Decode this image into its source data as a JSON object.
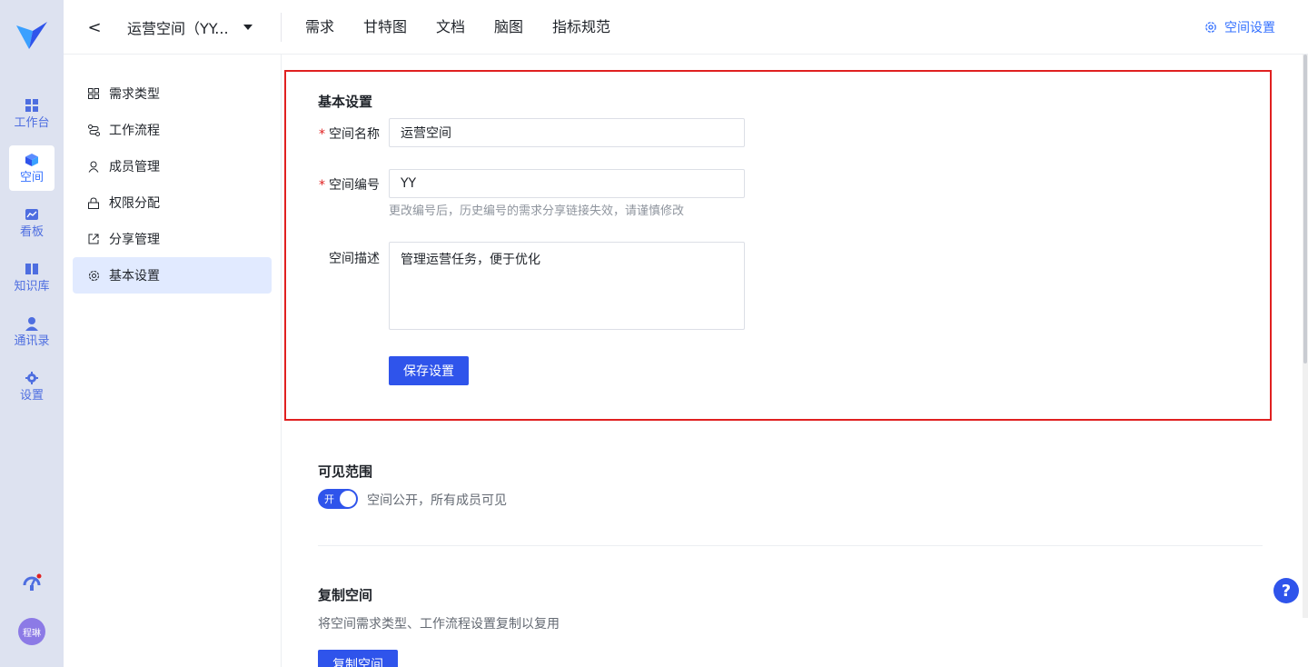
{
  "rail": {
    "items": [
      {
        "label": "工作台",
        "icon": "dashboard-icon"
      },
      {
        "label": "空间",
        "icon": "cube-icon",
        "active": true
      },
      {
        "label": "看板",
        "icon": "chart-icon"
      },
      {
        "label": "知识库",
        "icon": "book-icon"
      },
      {
        "label": "通讯录",
        "icon": "contacts-icon"
      },
      {
        "label": "设置",
        "icon": "gear-icon"
      }
    ],
    "avatar_text": "程琳"
  },
  "topbar": {
    "back": "<",
    "space_name": "运营空间（YY...",
    "tabs": [
      "需求",
      "甘特图",
      "文档",
      "脑图",
      "指标规范"
    ],
    "settings_label": "空间设置"
  },
  "subnav": {
    "items": [
      {
        "label": "需求类型",
        "icon": "grid-icon"
      },
      {
        "label": "工作流程",
        "icon": "flow-icon"
      },
      {
        "label": "成员管理",
        "icon": "user-icon"
      },
      {
        "label": "权限分配",
        "icon": "lock-icon"
      },
      {
        "label": "分享管理",
        "icon": "share-icon"
      },
      {
        "label": "基本设置",
        "icon": "gear-icon",
        "active": true
      }
    ]
  },
  "basic": {
    "title": "基本设置",
    "name_label": "空间名称",
    "name_value": "运营空间",
    "code_label": "空间编号",
    "code_value": "YY",
    "code_hint": "更改编号后，历史编号的需求分享链接失效，请谨慎修改",
    "desc_label": "空间描述",
    "desc_value": "管理运营任务，便于优化",
    "save_label": "保存设置",
    "required_mark": "*"
  },
  "visibility": {
    "title": "可见范围",
    "toggle_text": "开",
    "toggle_on": true,
    "desc": "空间公开，所有成员可见"
  },
  "copy": {
    "title": "复制空间",
    "desc": "将空间需求类型、工作流程设置复制以复用",
    "button_label": "复制空间"
  },
  "help": "?",
  "colors": {
    "accent": "#2f54eb",
    "link": "#3370ff",
    "highlight_border": "#e02020",
    "rail_bg": "#dde2f0",
    "nav_active_bg": "#e1eaff"
  }
}
